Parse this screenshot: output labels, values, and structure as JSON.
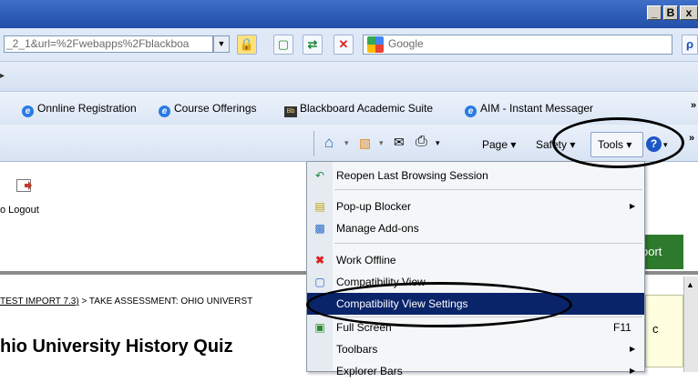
{
  "window": {
    "controls": [
      "_",
      "B",
      "x"
    ]
  },
  "address_bar": {
    "url": "_2_1&url=%2Fwebapps%2Fblackboa",
    "dropdown": "▼"
  },
  "toolbar_icons": [
    "lock-icon",
    "compat-view-icon",
    "refresh-icon",
    "stop-icon"
  ],
  "search": {
    "engine": "Google",
    "button": "ρ",
    "dropdown": "▾"
  },
  "menu_bar": {
    "overflow": "»"
  },
  "favorites": {
    "items": [
      {
        "label": "Onnline Registration",
        "icon": "ie-icon"
      },
      {
        "label": "Course Offerings",
        "icon": "ie-icon"
      },
      {
        "label": "Blackboard Academic Suite",
        "icon": "bb-icon"
      },
      {
        "label": "AIM - Instant Messager",
        "icon": "ie-icon"
      }
    ],
    "overflow": "»"
  },
  "command_bar": {
    "home": "⌂",
    "feeds": "▧",
    "mail": "✉",
    "print": "⎙",
    "page": "Page ▾",
    "safety": "Safety ▾",
    "tools": "Tools ▾",
    "help": "?",
    "overflow": "»"
  },
  "page": {
    "logout": "o Logout",
    "green_tab": "port",
    "breadcrumb_link": "TEST  IMPORT  7.3)",
    "breadcrumb_rest": " > TAKE ASSESSMENT: OHIO UNIVERST",
    "title": "hio University History Quiz",
    "yellow_box_text": "c"
  },
  "tools_menu": {
    "items": [
      {
        "label": "Reopen Last Browsing Session",
        "icon": "reopen-icon",
        "submenu": false,
        "shortcut": ""
      },
      {
        "label": "Pop-up Blocker",
        "icon": "popup-blocker-icon",
        "submenu": true,
        "shortcut": ""
      },
      {
        "label": "Manage Add-ons",
        "icon": "addons-icon",
        "submenu": false,
        "shortcut": ""
      },
      {
        "label": "Work Offline",
        "icon": "offline-icon",
        "submenu": false,
        "shortcut": ""
      },
      {
        "label": "Compatibility View",
        "icon": "compat-icon",
        "submenu": false,
        "shortcut": ""
      },
      {
        "label": "Compatibility View Settings",
        "icon": "",
        "submenu": false,
        "shortcut": "",
        "selected": true
      },
      {
        "label": "Full Screen",
        "icon": "fullscreen-icon",
        "submenu": false,
        "shortcut": "F11"
      },
      {
        "label": "Toolbars",
        "icon": "",
        "submenu": true,
        "shortcut": ""
      },
      {
        "label": "Explorer Bars",
        "icon": "",
        "submenu": true,
        "shortcut": ""
      }
    ]
  },
  "colors": {
    "selection": "#0a246a",
    "titlebar": "#2c5bb6",
    "green_tab": "#2d7a2d",
    "annotation": "#000000"
  }
}
